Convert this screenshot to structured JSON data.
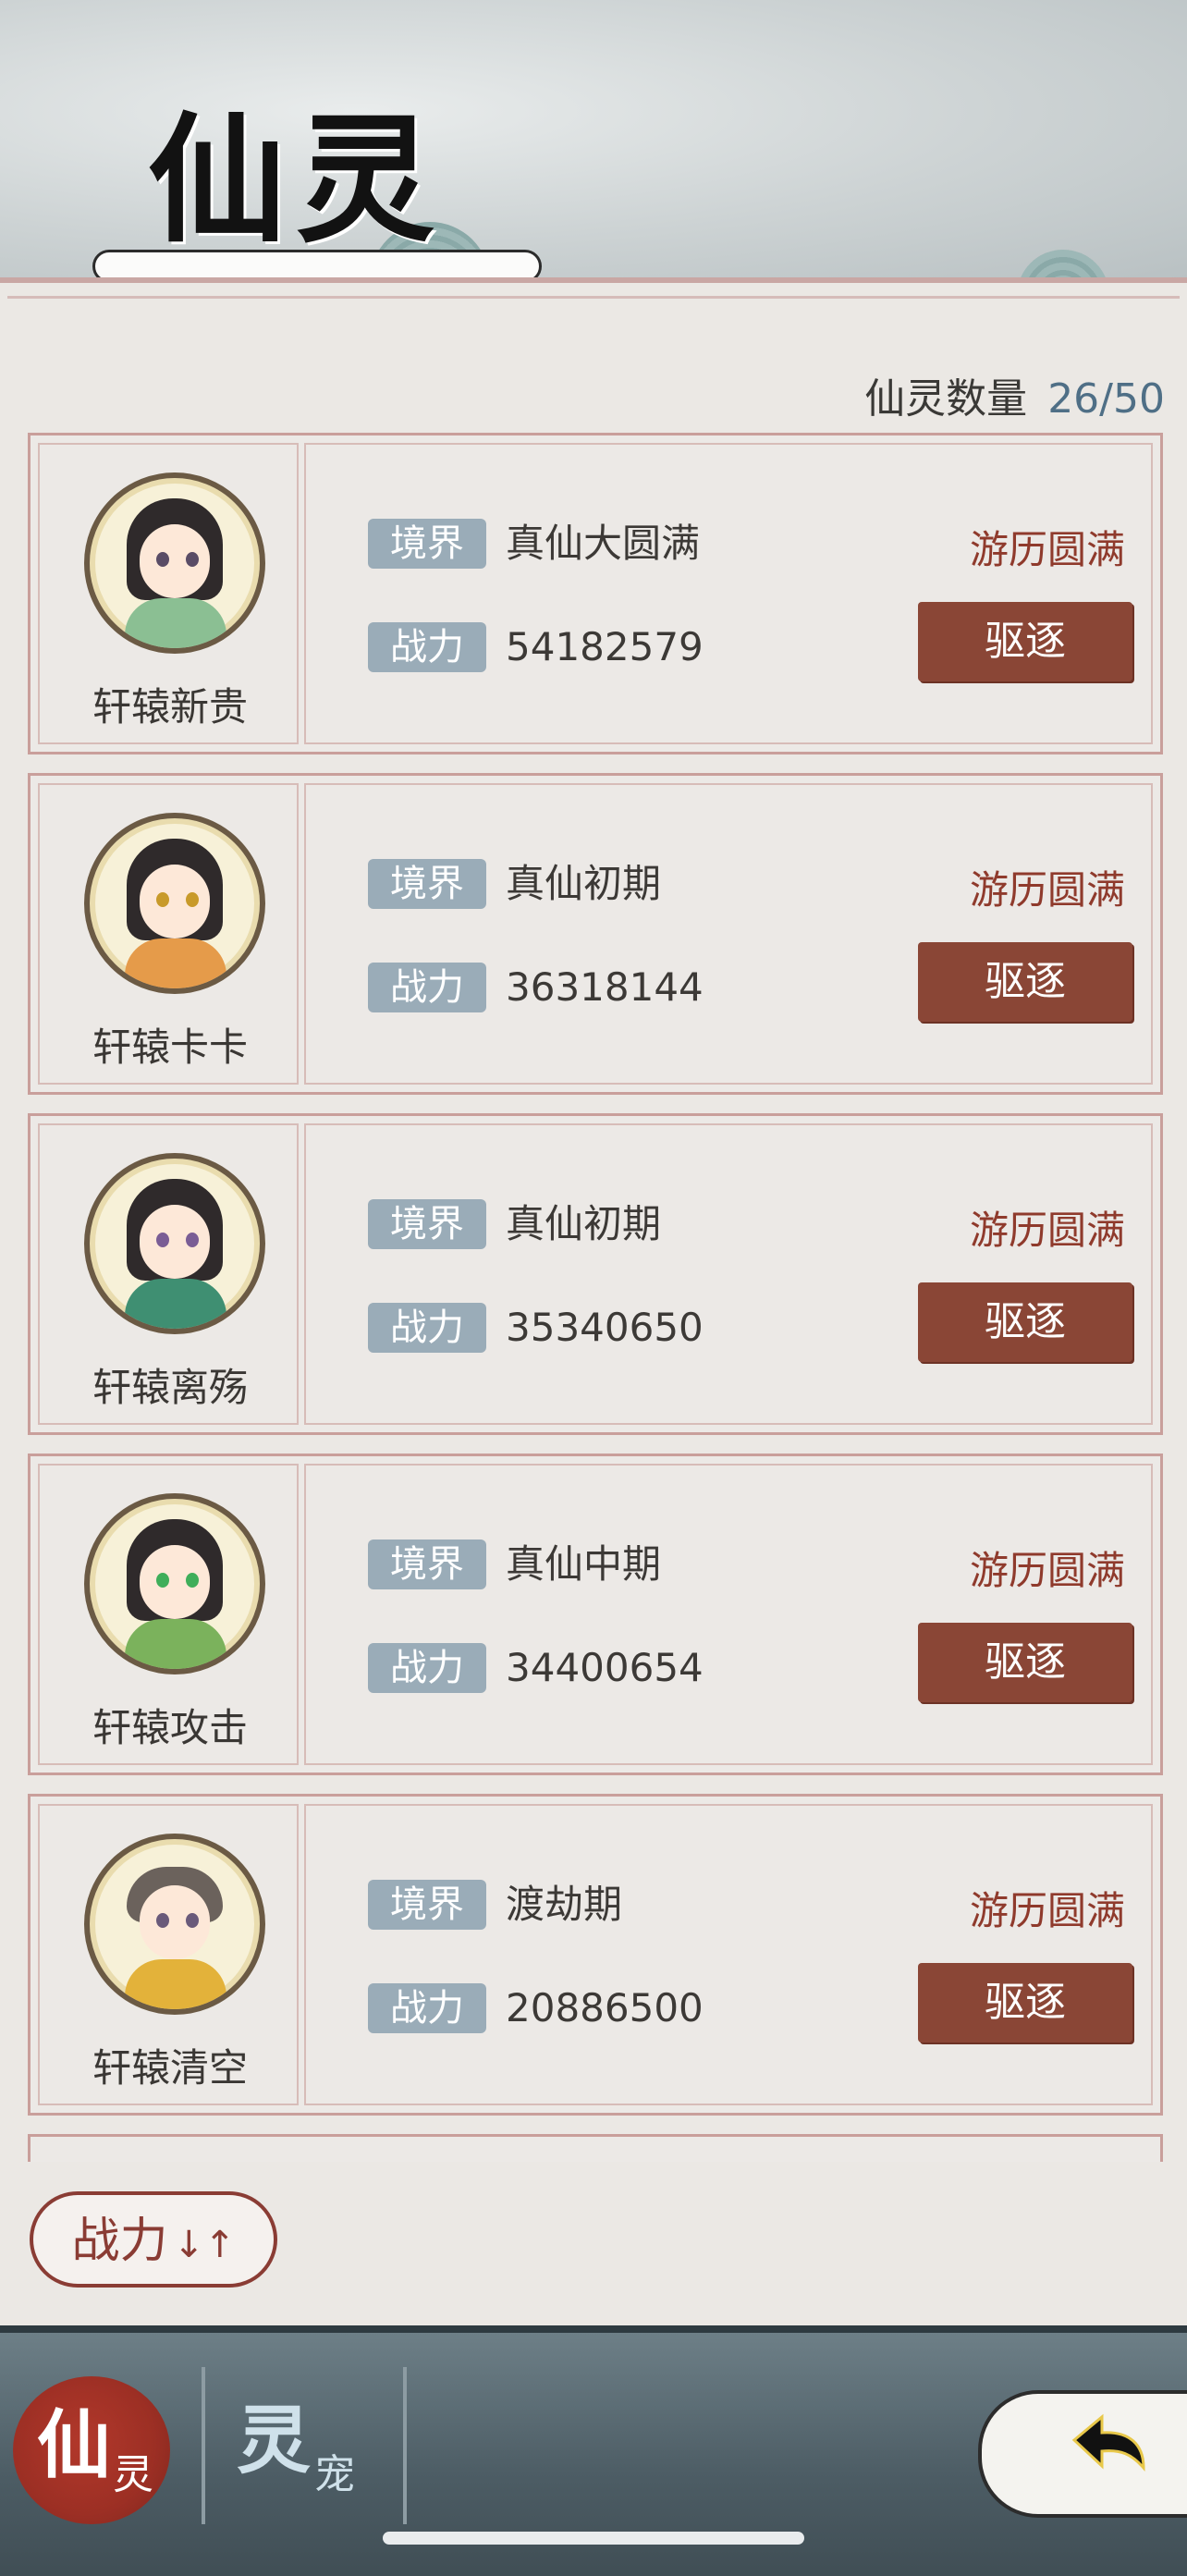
{
  "header": {
    "title": "仙灵"
  },
  "count": {
    "label": "仙灵数量",
    "value": "26/50"
  },
  "labels": {
    "realm": "境界",
    "power": "战力"
  },
  "spirits": [
    {
      "name": "轩辕新贵",
      "realm": "真仙大圆满",
      "power": "54182579",
      "status": "游历圆满",
      "action": "驱逐",
      "robe_color": "#8bbf93"
    },
    {
      "name": "轩辕卡卡",
      "realm": "真仙初期",
      "power": "36318144",
      "status": "游历圆满",
      "action": "驱逐",
      "robe_color": "#e59b4a"
    },
    {
      "name": "轩辕离殇",
      "realm": "真仙初期",
      "power": "35340650",
      "status": "游历圆满",
      "action": "驱逐",
      "robe_color": "#3f8f72"
    },
    {
      "name": "轩辕攻击",
      "realm": "真仙中期",
      "power": "34400654",
      "status": "游历圆满",
      "action": "驱逐",
      "robe_color": "#7bb25c"
    },
    {
      "name": "轩辕清空",
      "realm": "渡劫期",
      "power": "20886500",
      "status": "游历圆满",
      "action": "驱逐",
      "robe_color": "#e3b23a"
    }
  ],
  "sort": {
    "label": "战力",
    "arrows": "↓↑"
  },
  "tabs": [
    {
      "main": "仙",
      "sub": "灵",
      "active": true
    },
    {
      "main": "灵",
      "sub": "宠",
      "active": false
    }
  ],
  "colors": {
    "accent": "#8a4636",
    "tag": "#9aacb8",
    "status": "#8f3a2c"
  }
}
